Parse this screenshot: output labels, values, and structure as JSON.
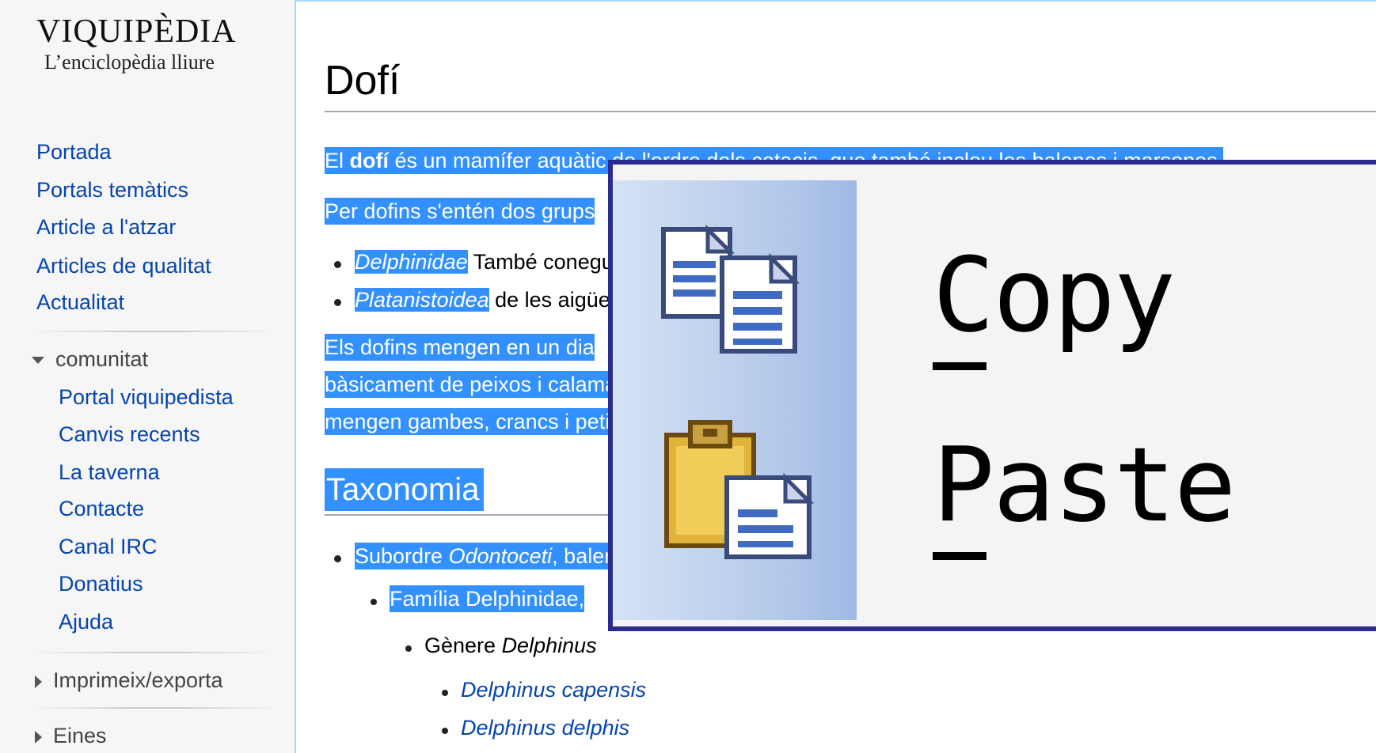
{
  "sidebar": {
    "logo": {
      "title": "VIQUIPÈDIA",
      "tagline": "L’enciclopèdia lliure"
    },
    "nav": [
      "Portada",
      "Portals temàtics",
      "Article a l'atzar",
      "Articles de qualitat",
      "Actualitat"
    ],
    "community": {
      "heading": "comunitat",
      "items": [
        "Portal viquipedista",
        "Canvis recents",
        "La taverna",
        "Contacte",
        "Canal IRC",
        "Donatius",
        "Ajuda"
      ]
    },
    "print_export": "Imprimeix/exporta",
    "tools": "Eines"
  },
  "article": {
    "title": "Dofí",
    "para1": {
      "pre": "El ",
      "bold": "dofí",
      "post": " és un mamífer aquàtic de l'ordre dels cetacis, que també inclou les balenes i marsopes."
    },
    "para2": "Per dofins s'entén dos grups",
    "list1": [
      {
        "italic": "Delphinidae",
        "rest": " També coneguts"
      },
      {
        "italic": "Platanistoidea",
        "rest": " de les aigües"
      }
    ],
    "para3": [
      "Els dofins mengen en un dia",
      "bàsicament de peixos i calamars",
      "mengen gambes, crancs i petits"
    ],
    "section_heading": "Taxonomia",
    "taxonomy": {
      "suborder": {
        "pre": "Subordre ",
        "italic": "Odontoceti",
        "post": ", balenes"
      },
      "family": "Família Delphinidae,",
      "genus": {
        "pre": "Gènere ",
        "italic": "Delphinus"
      },
      "species": [
        "Delphinus capensis",
        "Delphinus delphis"
      ]
    }
  },
  "context_menu": {
    "items": [
      {
        "label": "Copy",
        "accelerator": "C",
        "icon": "copy-icon"
      },
      {
        "label": "Paste",
        "accelerator": "P",
        "icon": "paste-icon"
      }
    ]
  },
  "colors": {
    "selection": "#3390ff",
    "link": "#0645ad",
    "menu_border": "#2b2b8f"
  }
}
